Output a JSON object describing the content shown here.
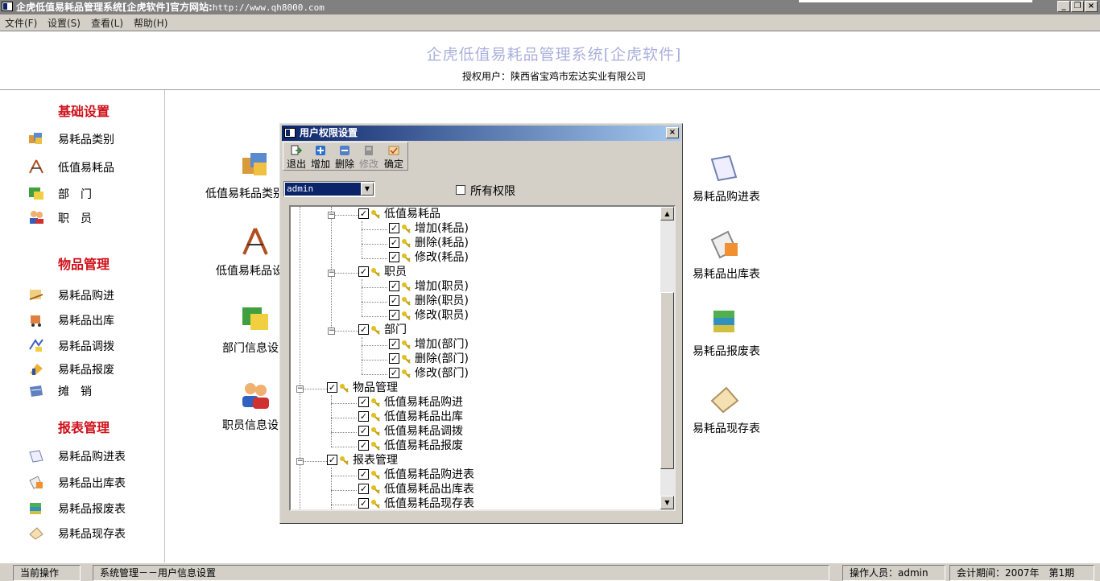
{
  "window": {
    "title": "企虎低值易耗品管理系统[企虎软件]官方网站:",
    "url": "http://www.qh8000.com"
  },
  "menu": [
    "文件(F)",
    "设置(S)",
    "查看(L)",
    "帮助(H)"
  ],
  "header": {
    "app_title": "企虎低值易耗品管理系统[企虎软件]",
    "licensed_user": "授权用户：陕西省宝鸡市宏达实业有限公司"
  },
  "sidebar": {
    "sections": [
      {
        "title": "基础设置",
        "items": [
          "易耗品类别",
          "低值易耗品",
          "部　门",
          "职　员"
        ]
      },
      {
        "title": "物品管理",
        "items": [
          "易耗品购进",
          "易耗品出库",
          "易耗品调拨",
          "易耗品报废",
          "摊　销"
        ]
      },
      {
        "title": "报表管理",
        "items": [
          "易耗品购进表",
          "易耗品出库表",
          "易耗品报废表",
          "易耗品现存表"
        ]
      }
    ]
  },
  "main": {
    "left_items": [
      "低值易耗品类别",
      "低值易耗品设",
      "部门信息设",
      "职员信息设"
    ],
    "right_items": [
      "易耗品购进表",
      "易耗品出库表",
      "易耗品报废表",
      "易耗品现存表"
    ]
  },
  "dialog": {
    "title": "用户权限设置",
    "toolbar": [
      {
        "label": "退出",
        "enabled": true
      },
      {
        "label": "增加",
        "enabled": true
      },
      {
        "label": "删除",
        "enabled": true
      },
      {
        "label": "修改",
        "enabled": false
      },
      {
        "label": "确定",
        "enabled": true
      }
    ],
    "user_select": "admin",
    "all_permissions_label": "所有权限",
    "all_permissions_checked": false,
    "tree": [
      {
        "label": "低值易耗品",
        "checked": true
      },
      {
        "label": "增加(耗品)",
        "checked": true
      },
      {
        "label": "删除(耗品)",
        "checked": true
      },
      {
        "label": "修改(耗品)",
        "checked": true
      },
      {
        "label": "职员",
        "checked": true
      },
      {
        "label": "增加(职员)",
        "checked": true
      },
      {
        "label": "删除(职员)",
        "checked": true
      },
      {
        "label": "修改(职员)",
        "checked": true
      },
      {
        "label": "部门",
        "checked": true
      },
      {
        "label": "增加(部门)",
        "checked": true
      },
      {
        "label": "删除(部门)",
        "checked": true
      },
      {
        "label": "修改(部门)",
        "checked": true
      },
      {
        "label": "物品管理",
        "checked": true
      },
      {
        "label": "低值易耗品购进",
        "checked": true
      },
      {
        "label": "低值易耗品出库",
        "checked": true
      },
      {
        "label": "低值易耗品调拨",
        "checked": true
      },
      {
        "label": "低值易耗品报废",
        "checked": true
      },
      {
        "label": "报表管理",
        "checked": true
      },
      {
        "label": "低值易耗品购进表",
        "checked": true
      },
      {
        "label": "低值易耗品出库表",
        "checked": true
      },
      {
        "label": "低值易耗品现存表",
        "checked": true
      }
    ]
  },
  "status": {
    "current_op_label": "当前操作",
    "current_op": "系统管理－－用户信息设置",
    "operator": "操作人员：admin",
    "period": "会计期间：2007年　第1期"
  },
  "icons": {
    "sidebar": [
      "category-icon",
      "tools-icon",
      "department-icon",
      "staff-icon",
      "purchase-icon",
      "outbound-icon",
      "transfer-icon",
      "scrap-icon",
      "amortize-icon",
      "purchase-report-icon",
      "outbound-report-icon",
      "scrap-report-icon",
      "stock-report-icon"
    ]
  },
  "colors": {
    "section_red": "#d0101a",
    "title_lavender": "#aab0dc",
    "dialog_title_start": "#0a246a",
    "dialog_title_end": "#a6caf0"
  }
}
